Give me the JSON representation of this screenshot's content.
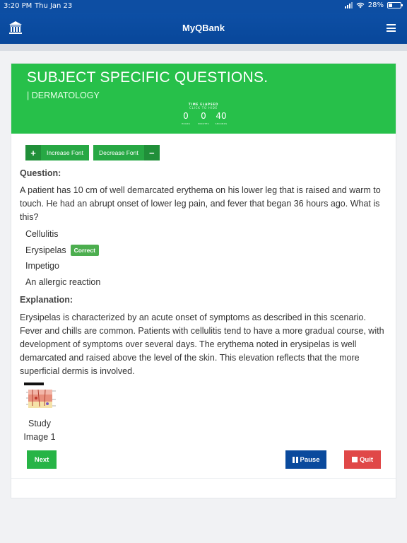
{
  "statusbar": {
    "time": "3:20 PM",
    "date": "Thu Jan 23",
    "battery": "28%"
  },
  "nav": {
    "title": "MyQBank",
    "logo_icon": "bank-building-icon",
    "menu_icon": "hamburger-menu-icon"
  },
  "banner": {
    "title": "SUBJECT SPECIFIC QUESTIONS.",
    "subject": "| DERMATOLOGY",
    "timer": {
      "label": "TIME ELAPSED",
      "hint": "CLICK TO HIDE",
      "hours": "0",
      "minutes": "0",
      "seconds": "40",
      "hours_label": "HOURS",
      "minutes_label": "MINUTES",
      "seconds_label": "SECONDS"
    },
    "color": "#27c04a"
  },
  "font_controls": {
    "increase_label": "Increase Font",
    "decrease_label": "Decrease Font",
    "plus": "+",
    "minus": "−"
  },
  "question": {
    "heading": "Question:",
    "text": "A patient has 10 cm of well demarcated erythema on his lower leg that is raised and warm to touch. He had an abrupt onset of lower leg pain, and fever that began 36 hours ago. What is this?",
    "answers": [
      {
        "label": "Cellulitis"
      },
      {
        "label": "Erysipelas",
        "badge": "Correct"
      },
      {
        "label": "Impetigo"
      },
      {
        "label": "An allergic reaction"
      }
    ]
  },
  "explanation": {
    "heading": "Explanation:",
    "text": "Erysipelas is characterized by an acute onset of symptoms as described in this scenario. Fever and chills are common. Patients with cellulitis tend to have a more gradual course, with development of symptoms over several days. The erythema noted in erysipelas is well demarcated and raised above the level of the skin. This elevation reflects that the more superficial dermis is involved."
  },
  "study_image": {
    "label": "Study Image 1",
    "icon": "skin-layers-diagram-thumbnail"
  },
  "actions": {
    "next_label": "Next",
    "pause_label": "Pause",
    "quit_label": "Quit"
  }
}
